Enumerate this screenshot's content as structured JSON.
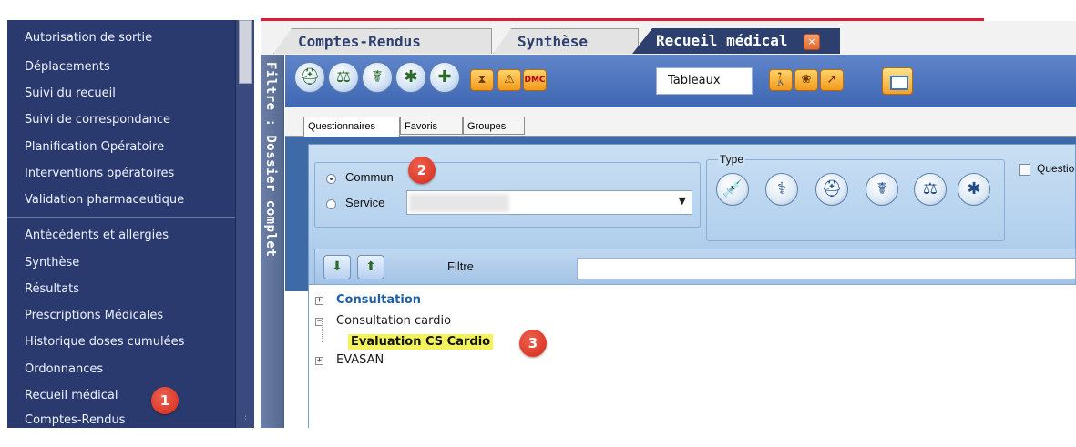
{
  "sidebar": {
    "items": [
      {
        "label": "Autorisation de sortie"
      },
      {
        "label": "Déplacements"
      },
      {
        "label": "Suivi du recueil"
      },
      {
        "label": "Suivi de correspondance"
      },
      {
        "label": "Planification Opératoire"
      },
      {
        "label": "Interventions opératoires"
      },
      {
        "label": "Validation pharmaceutique"
      },
      {
        "label": "Antécédents et allergies"
      },
      {
        "label": "Synthèse"
      },
      {
        "label": "Résultats"
      },
      {
        "label": "Prescriptions Médicales"
      },
      {
        "label": "Historique doses cumulées"
      },
      {
        "label": "Ordonnances"
      },
      {
        "label": "Recueil médical"
      },
      {
        "label": "Comptes-Rendus"
      }
    ]
  },
  "vertical_filter": {
    "label": "Filtre : Dossier complet"
  },
  "tabs": [
    {
      "label": "Comptes-Rendus",
      "active": false
    },
    {
      "label": "Synthèse",
      "active": false
    },
    {
      "label": "Recueil médical",
      "active": true
    }
  ],
  "tab_close_glyph": "×",
  "toolbar": {
    "tableaux_label": "Tableaux",
    "dmc_label": "DMC",
    "icons": [
      "nurse-cap-icon",
      "scale-icon",
      "caduceus-icon",
      "star-of-life-icon",
      "bandage-icon",
      "hourglass-icon",
      "alert-icon",
      "dmc-icon",
      "walking-icon",
      "leaf-icon",
      "export-icon",
      "window-icon"
    ]
  },
  "subtabs": [
    {
      "label": "Questionnaires",
      "active": true
    },
    {
      "label": "Favoris",
      "active": false
    },
    {
      "label": "Groupes",
      "active": false
    }
  ],
  "scope": {
    "commun_label": "Commun",
    "service_label": "Service",
    "selected": "Commun"
  },
  "type_group": {
    "legend": "Type",
    "icons": [
      "injection-icon",
      "caduceus-staff-icon",
      "nurse-cap-icon",
      "serpent-icon",
      "scale-icon",
      "star-of-life-icon"
    ]
  },
  "questio_label": "Questio",
  "filter": {
    "label": "Filtre",
    "value": ""
  },
  "tree": {
    "nodes": [
      {
        "label": "Consultation",
        "expander": "+"
      },
      {
        "label": "Consultation cardio",
        "expander": "−"
      },
      {
        "label": "Evaluation CS Cardio",
        "highlighted": true,
        "highlight_color": "#f4f45a"
      },
      {
        "label": "EVASAN",
        "expander": "+"
      }
    ]
  },
  "markers": [
    {
      "number": "1"
    },
    {
      "number": "2"
    },
    {
      "number": "3"
    }
  ],
  "colors": {
    "sidebar_bg": "#2b3a6e",
    "active_tab_bg": "#2d3f6e",
    "accent_red": "#d81e3a",
    "marker_red": "#d42a1a"
  }
}
